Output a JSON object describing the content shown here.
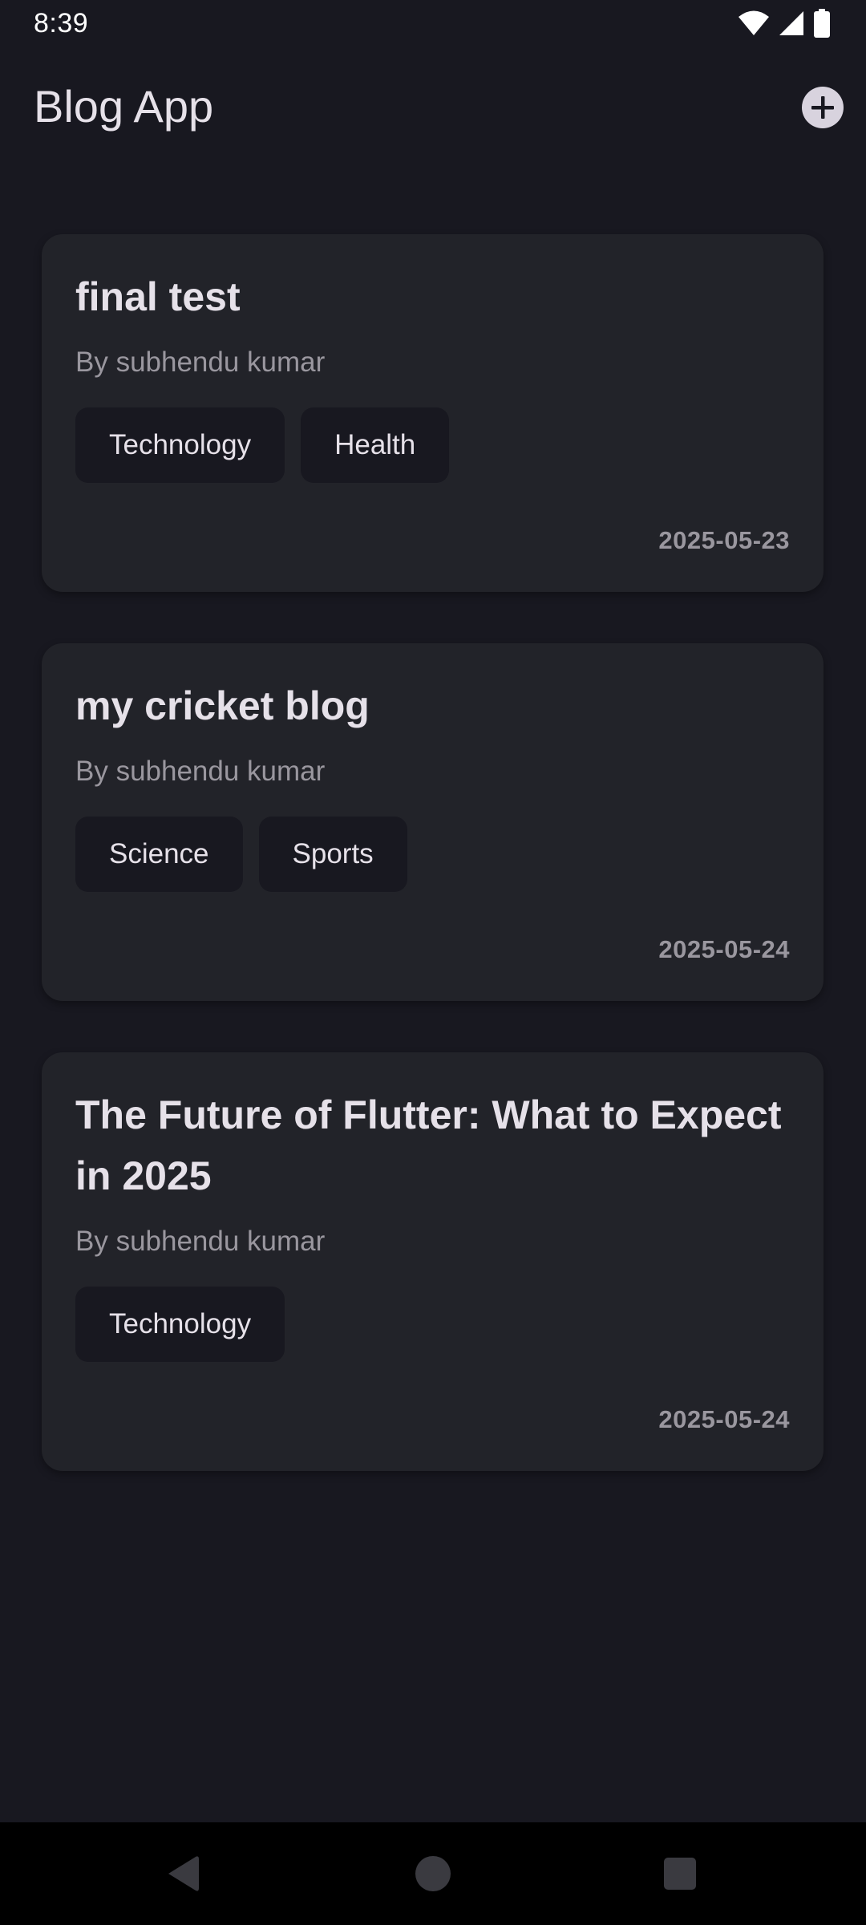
{
  "status_bar": {
    "time": "8:39",
    "icons": [
      "wifi-icon",
      "signal-icon",
      "battery-icon"
    ]
  },
  "app_bar": {
    "title": "Blog App",
    "add_icon": "add-circle-icon"
  },
  "posts": [
    {
      "title": "final test",
      "author": "By subhendu kumar",
      "tags": [
        "Technology",
        "Health"
      ],
      "date": "2025-05-23"
    },
    {
      "title": "my cricket blog",
      "author": "By subhendu kumar",
      "tags": [
        "Science",
        "Sports"
      ],
      "date": "2025-05-24"
    },
    {
      "title": "The Future of Flutter: What to Expect in 2025",
      "author": "By subhendu kumar",
      "tags": [
        "Technology"
      ],
      "date": "2025-05-24"
    }
  ],
  "nav_bar": {
    "icons": [
      "back-icon",
      "home-icon",
      "recents-icon"
    ]
  },
  "colors": {
    "background": "#181820",
    "card": "#222329",
    "chip": "#181820",
    "text_primary": "#E6E1E9",
    "text_secondary": "#9A979F"
  }
}
